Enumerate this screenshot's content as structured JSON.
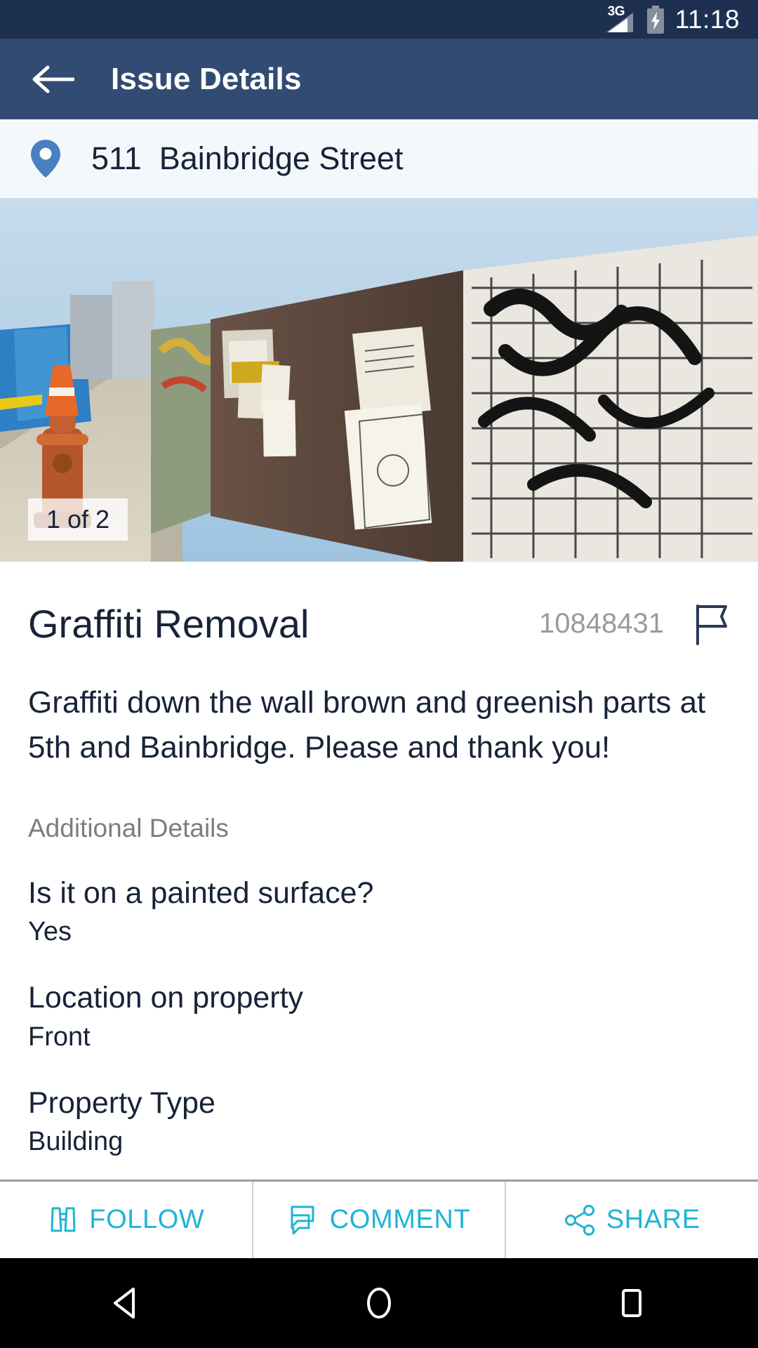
{
  "status_bar": {
    "network": "3G",
    "time": "11:18",
    "battery_state": "charging"
  },
  "app_bar": {
    "title": "Issue Details",
    "back_icon": "arrow-left-icon",
    "background": "#314b73"
  },
  "photo": {
    "address": "511  Bainbridge Street",
    "pin_icon": "map-pin-icon",
    "counter": "1 of 2",
    "accent": "#4a7fc1"
  },
  "issue": {
    "title": "Graffiti Removal",
    "id": "10848431",
    "flag_icon": "flag-icon",
    "description": "Graffiti down the wall brown and greenish parts at 5th and Bainbridge. Please and thank you!",
    "additional_details_label": "Additional Details",
    "details": [
      {
        "question": "Is it on a painted surface?",
        "answer": "Yes"
      },
      {
        "question": "Location on property",
        "answer": "Front"
      },
      {
        "question": "Property Type",
        "answer": "Building"
      }
    ]
  },
  "actions": [
    {
      "label": "FOLLOW",
      "icon": "binoculars-icon"
    },
    {
      "label": "COMMENT",
      "icon": "comment-bubbles-icon"
    },
    {
      "label": "SHARE",
      "icon": "share-nodes-icon"
    }
  ],
  "action_color": "#1fb4d4",
  "nav_bar": {
    "back": "triangle-back-icon",
    "home": "circle-home-icon",
    "recents": "square-recents-icon"
  }
}
